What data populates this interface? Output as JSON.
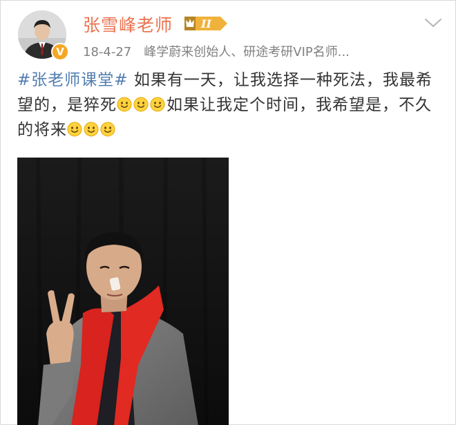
{
  "user": {
    "name": "张雪峰老师",
    "level_badge": "II",
    "verified_mark": "V",
    "avatar_icon": "avatar-portrait"
  },
  "meta": {
    "date": "18-4-27",
    "bio": "峰学蔚来创始人、研途考研VIP名师..."
  },
  "post": {
    "topic": "#张老师课堂#",
    "segments": [
      " 如果有一天，让我选择一种死法，我最希望的，是猝死",
      "如果让我定个时间，我希望是，不久的将来"
    ],
    "emoji_name": "smile-emoji-icon"
  },
  "photo": {
    "description_icon": "post-photo"
  },
  "colors": {
    "name": "#eb7350",
    "topic": "#507daf",
    "badge": "#f5a623",
    "text": "#333333",
    "meta": "#808080"
  }
}
